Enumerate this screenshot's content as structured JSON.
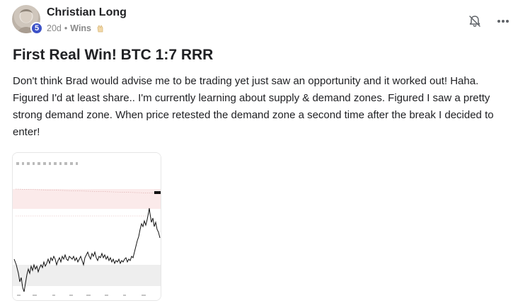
{
  "post": {
    "author": "Christian Long",
    "level": "5",
    "time": "20d",
    "separator": "•",
    "category": "Wins",
    "title": "First Real Win! BTC 1:7 RRR",
    "body": "Don't think Brad would advise me to be trading yet just saw an opportunity and it worked out! Haha. Figured I'd at least share.. I'm currently learning about supply & demand zones. Figured I saw a pretty strong demand zone. When price retested the demand zone a second time after the break I decided to enter!"
  },
  "icons": {
    "avatar": "avatar-photo",
    "hands": "clapping-hands-icon",
    "bell": "bell-off-icon",
    "more": "more-horizontal-icon"
  },
  "colors": {
    "level_badge": "#3d52c7",
    "text_primary": "#202124",
    "text_meta": "#8a8a8a",
    "demand_zone": "#eeeeee",
    "supply_zone": "#fbeaea",
    "price_line": "#111111"
  }
}
